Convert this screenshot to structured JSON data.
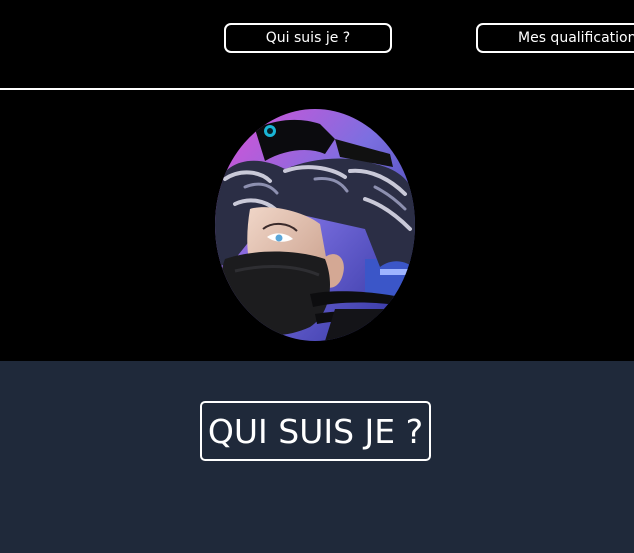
{
  "nav": {
    "items": [
      {
        "label": "Qui suis je ?"
      },
      {
        "label": "Mes qualifications"
      }
    ]
  },
  "hero": {
    "avatar_icon": "avatar-portrait"
  },
  "about": {
    "title": "QUI SUIS JE ?"
  },
  "colors": {
    "nav_bg": "#000000",
    "hero_bg": "#000000",
    "about_bg": "#1f293a",
    "border": "#ffffff",
    "text": "#ffffff"
  }
}
